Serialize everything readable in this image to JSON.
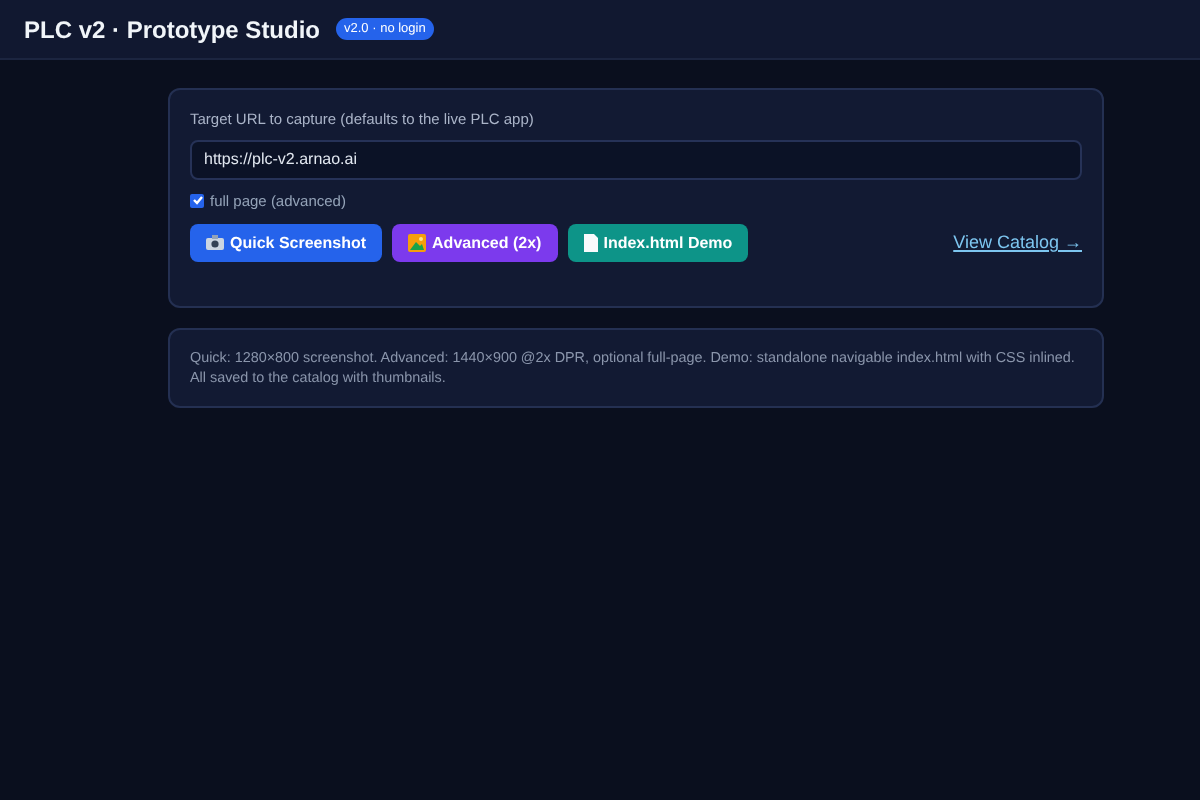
{
  "header": {
    "title": "PLC v2 · Prototype Studio",
    "badge": "v2.0 · no login"
  },
  "capture": {
    "label": "Target URL to capture (defaults to the live PLC app)",
    "url": "https://plc-v2.arnao.ai",
    "full_page": {
      "label": "full page (advanced)",
      "checked": true
    },
    "buttons": [
      {
        "kind": "camera",
        "label": "Quick Screenshot",
        "color": "#2563eb"
      },
      {
        "kind": "picture",
        "label": "Advanced (2x)",
        "color": "#7c3aed"
      },
      {
        "kind": "page",
        "label": "Index.html Demo",
        "color": "#0d9488"
      }
    ],
    "link": "View Catalog →"
  },
  "info": "Quick: 1280×800 screenshot. Advanced: 1440×900 @2x DPR, optional full-page. Demo: standalone navigable index.html with CSS inlined. All saved to the catalog with thumbnails."
}
